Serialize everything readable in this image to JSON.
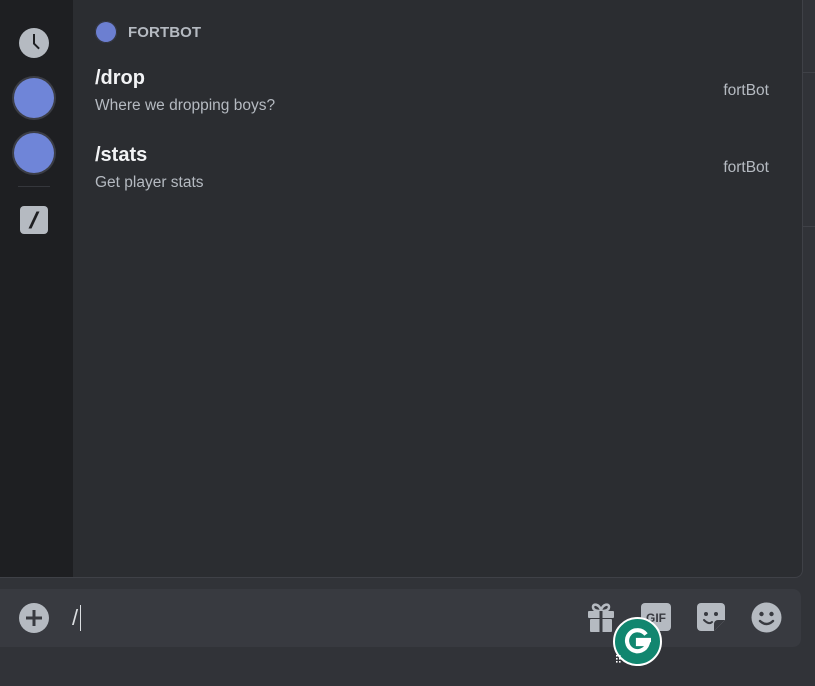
{
  "autocomplete": {
    "section_title": "FORTBOT",
    "commands": [
      {
        "name": "/drop",
        "description": "Where we dropping boys?",
        "app": "fortBot"
      },
      {
        "name": "/stats",
        "description": "Get player stats",
        "app": "fortBot"
      }
    ]
  },
  "rail": {
    "items": [
      {
        "icon": "clock-icon",
        "label": "Recent"
      },
      {
        "icon": "bot-avatar",
        "label": "Bot"
      },
      {
        "icon": "bot-avatar",
        "label": "Bot"
      },
      {
        "icon": "slash-command-icon",
        "label": "Built-in"
      }
    ]
  },
  "composer": {
    "value": "/",
    "icons": [
      "add-icon",
      "gift-icon",
      "gif-icon",
      "sticker-icon",
      "emoji-icon"
    ],
    "gif_label": "GIF"
  },
  "colors": {
    "background": "#313338",
    "popover": "#2b2d31",
    "rail": "#1e1f22",
    "avatar": "#6f85d8",
    "composer": "#383a40",
    "grammarly": "#11866f"
  }
}
